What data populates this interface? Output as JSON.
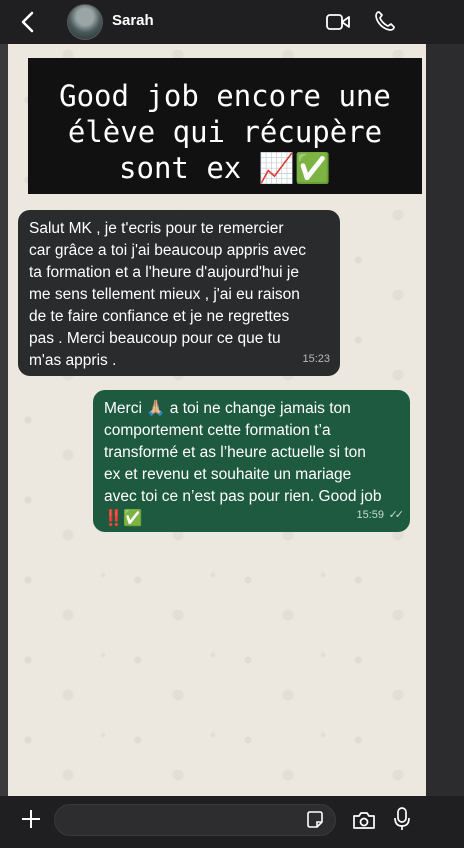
{
  "header": {
    "back_icon": "chevron-left-icon",
    "contact_name": "Sarah",
    "video_icon": "video-call-icon",
    "phone_icon": "phone-icon"
  },
  "banner": {
    "lines": [
      "Good job encore une",
      "élève qui récupère",
      "sont ex 📈✅"
    ]
  },
  "messages": [
    {
      "direction": "incoming",
      "lines": [
        "Salut MK , je t'ecris pour te remercier",
        "car grâce a toi j'ai beaucoup appris avec",
        "ta formation et a l'heure d'aujourd'hui je",
        "me sens tellement mieux , j'ai eu raison",
        "de te faire confiance et je ne regrettes",
        "pas . Merci beaucoup pour ce que tu",
        "m'as appris ."
      ],
      "time": "15:23"
    },
    {
      "direction": "outgoing",
      "lines": [
        "Merci 🙏🏼 a toi ne change jamais ton",
        "comportement cette formation t’a",
        "transformé et as l’heure actuelle si ton",
        "ex et revenu et souhaite un mariage",
        "avec toi ce n’est pas pour rien. Good job",
        "‼️✅"
      ],
      "time": "15:59",
      "status": "read"
    }
  ],
  "composer": {
    "plus_icon": "plus-icon",
    "sticker_icon": "sticker-icon",
    "camera_icon": "camera-icon",
    "mic_icon": "microphone-icon"
  },
  "colors": {
    "incoming_bubble": "#2a2b2d",
    "outgoing_bubble": "#1e5a3f",
    "wallpaper": "#ece7df",
    "bar": "#1f1f21"
  }
}
